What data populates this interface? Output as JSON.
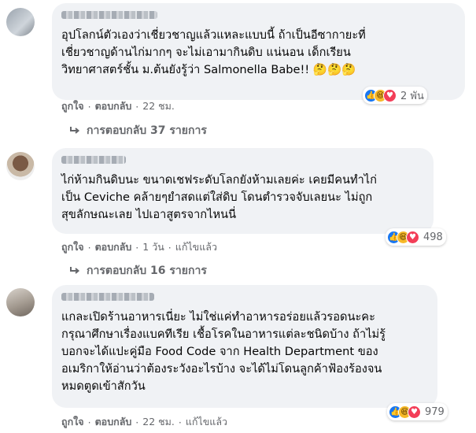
{
  "comments": [
    {
      "text": "อุปโลกน์ตัวเองว่าเชี่ยวชาญแล้วแหละแบบนี้ ถ้าเป็นอีซากายะที่\nเชี่ยวชาญด้านไก่มากๆ จะไม่เอามากินดิบ แน่นอน เด็กเรียน\nวิทยาศาสตร์ชั้น ม.ต้นยังรู้ว่า Salmonella Babe!! 🤔🤔🤔",
      "reaction_count": "2 พัน",
      "like": "ถูกใจ",
      "reply": "ตอบกลับ",
      "time": "22 ชม.",
      "edited": "",
      "replies": "การตอบกลับ 37 รายการ"
    },
    {
      "text": "ไก่ห้ามกินดิบนะ ขนาดเชฟระดับโลกยังห้ามเลยค่ะ เคยมีคนทำไก่\nเป็น Ceviche คล้ายๆยำสดแต่ใส่ดิบ โดนตำรวจจับเลยนะ ไม่ถูก\nสุขลักษณะเลย ไปเอาสูตรจากไหนนี่",
      "reaction_count": "498",
      "like": "ถูกใจ",
      "reply": "ตอบกลับ",
      "time": "1 วัน",
      "edited": "แก้ไขแล้ว",
      "replies": "การตอบกลับ 16 รายการ"
    },
    {
      "text": "แกละเปิดร้านอาหารเนี่ยะ ไม่ใช่แค่ทำอาหารอร่อยแล้วรอดนะคะ\nกรุณาศึกษาเรื่องแบคทีเรีย เชื้อโรคในอาหารแต่ละชนิดบ้าง ถ้าไม่รู้\nบอกจะได้แปะคู่มือ Food Code จาก Health Department ของ\nอเมริกาให้อ่านว่าต้องระวังอะไรบ้าง จะได้ไม่โดนลูกค้าฟ้องร้องจน\nหมดตูดเข้าสักวัน",
      "reaction_count": "979",
      "like": "ถูกใจ",
      "reply": "ตอบกลับ",
      "time": "22 ชม.",
      "edited": "แก้ไขแล้ว",
      "replies": ""
    }
  ],
  "icons": {
    "like": "like-reaction-icon",
    "haha": "haha-reaction-icon",
    "love": "love-reaction-icon",
    "reply_arrow": "reply-arrow-icon"
  },
  "colors": {
    "bubble": "#f0f2f5",
    "secondary_text": "#65676b",
    "like_blue": "#1877f2",
    "love_red": "#f33e58",
    "haha_yellow": "#f7b928"
  }
}
